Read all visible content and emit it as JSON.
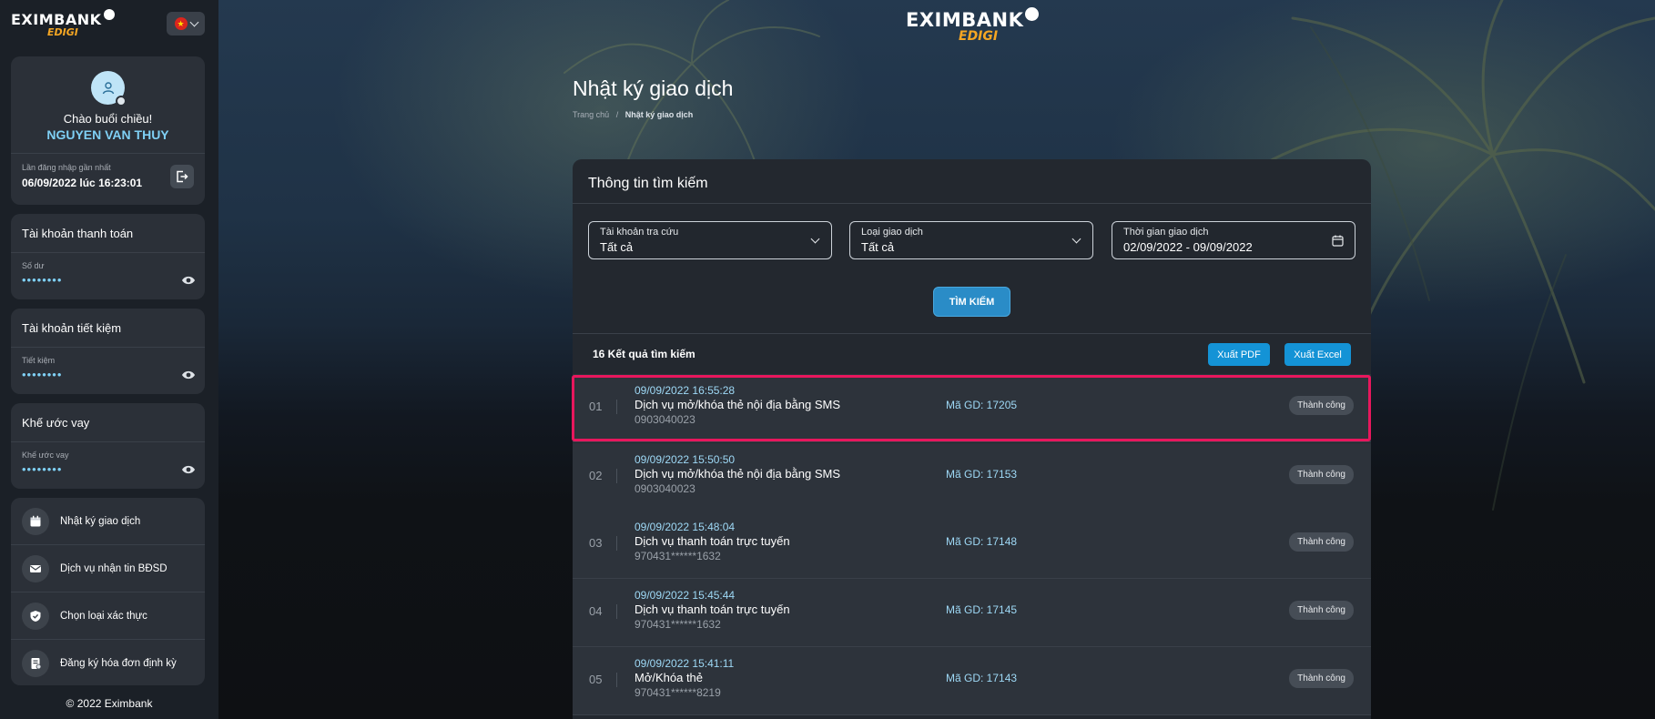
{
  "brand": {
    "name": "EXIMBANK",
    "sub": "EDIGI"
  },
  "sidebar": {
    "greeting": "Chào buổi chiều!",
    "user_name": "NGUYEN VAN THUY",
    "last_login_label": "Lần đăng nhập gần nhất",
    "last_login_value": "06/09/2022 lúc 16:23:01",
    "accounts": [
      {
        "title": "Tài khoản thanh toán",
        "label": "Số dư",
        "value": "••••••••"
      },
      {
        "title": "Tài khoản tiết kiệm",
        "label": "Tiết kiệm",
        "value": "••••••••"
      },
      {
        "title": "Khế ước vay",
        "label": "Khế ước vay",
        "value": "••••••••"
      }
    ],
    "menu": [
      {
        "label": "Nhật ký giao dịch",
        "icon": "calendar-icon"
      },
      {
        "label": "Dịch vụ nhận tin BĐSD",
        "icon": "message-icon"
      },
      {
        "label": "Chọn loại xác thực",
        "icon": "shield-icon"
      },
      {
        "label": "Đăng ký hóa đơn định kỳ",
        "icon": "bill-icon"
      }
    ],
    "copyright": "© 2022 Eximbank"
  },
  "main": {
    "title": "Nhật ký giao dịch",
    "breadcrumb": {
      "home": "Trang chủ",
      "separator": "/",
      "current": "Nhật ký giao dịch"
    },
    "search": {
      "title": "Thông tin tìm kiếm",
      "fields": [
        {
          "label": "Tài khoản tra cứu",
          "value": "Tất cả"
        },
        {
          "label": "Loại giao dịch",
          "value": "Tất cả"
        },
        {
          "label": "Thời gian giao dịch",
          "value": "02/09/2022 - 09/09/2022"
        }
      ],
      "button": "TÌM KIẾM"
    },
    "results": {
      "count_text": "16 Kết quả tìm kiếm",
      "export_pdf": "Xuất PDF",
      "export_excel": "Xuất Excel",
      "rows": [
        {
          "num": "01",
          "time": "09/09/2022 16:55:28",
          "name": "Dịch vụ mở/khóa thẻ nội địa bằng SMS",
          "sub": "0903040023",
          "code": "Mã GD: 17205",
          "status": "Thành công"
        },
        {
          "num": "02",
          "time": "09/09/2022 15:50:50",
          "name": "Dịch vụ mở/khóa thẻ nội địa bằng SMS",
          "sub": "0903040023",
          "code": "Mã GD: 17153",
          "status": "Thành công"
        },
        {
          "num": "03",
          "time": "09/09/2022 15:48:04",
          "name": "Dịch vụ thanh toán trực tuyến",
          "sub": "970431******1632",
          "code": "Mã GD: 17148",
          "status": "Thành công"
        },
        {
          "num": "04",
          "time": "09/09/2022 15:45:44",
          "name": "Dịch vụ thanh toán trực tuyến",
          "sub": "970431******1632",
          "code": "Mã GD: 17145",
          "status": "Thành công"
        },
        {
          "num": "05",
          "time": "09/09/2022 15:41:11",
          "name": "Mở/Khóa thẻ",
          "sub": "970431******8219",
          "code": "Mã GD: 17143",
          "status": "Thành công"
        }
      ]
    }
  },
  "colors": {
    "accent": "#7fd0f5",
    "highlight": "#e8175d",
    "button": "#2a8cc7",
    "export": "#1493d6"
  }
}
